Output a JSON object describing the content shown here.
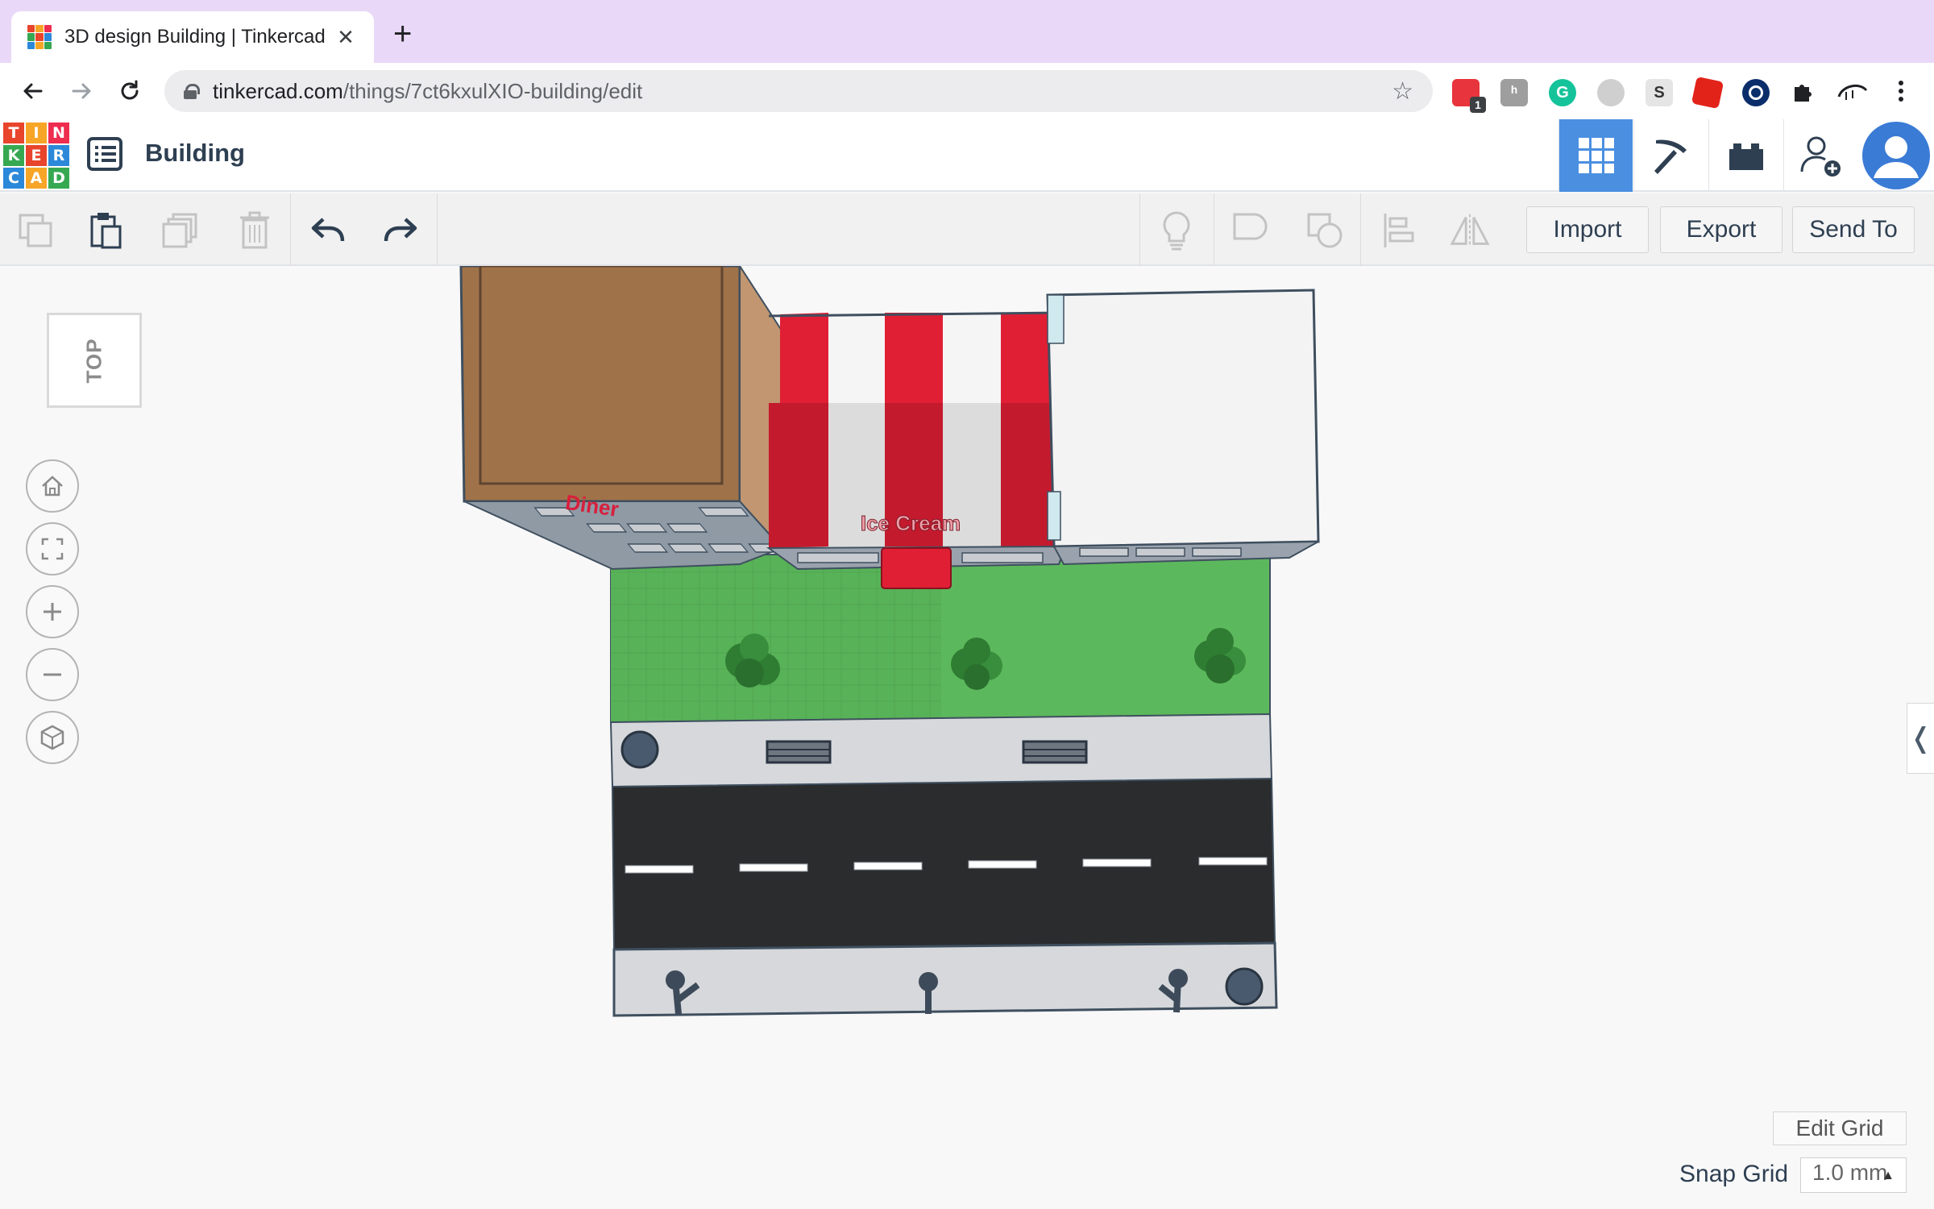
{
  "browser": {
    "tab_title": "3D design Building | Tinkercad",
    "tab_close": "✕",
    "new_tab": "+",
    "url_domain": "tinkercad.com",
    "url_path": "/things/7ct6kxulXIO-building/edit",
    "extension_badge": "1",
    "icons": [
      "back-arrow-icon",
      "forward-arrow-icon",
      "reload-icon",
      "lock-icon",
      "bookmark-star-icon",
      "puzzle-extensions-icon",
      "menu-dots-icon"
    ]
  },
  "app": {
    "logo_letters": [
      "T",
      "I",
      "N",
      "K",
      "E",
      "R",
      "C",
      "A",
      "D"
    ],
    "logo_colors": [
      "#e8452c",
      "#f7a526",
      "#ee2d4f",
      "#36a852",
      "#e8452c",
      "#2c88d9",
      "#2c88d9",
      "#f7a526",
      "#36a852"
    ],
    "design_title": "Building",
    "header_buttons": [
      "3d-view-grid-icon",
      "minecraft-pickaxe-icon",
      "lego-brick-icon",
      "add-user-icon",
      "profile-avatar"
    ],
    "accent_color": "#4a8fe0"
  },
  "toolbar": {
    "left_icons": [
      "copy-icon",
      "paste-icon",
      "duplicate-icon",
      "delete-icon",
      "undo-icon",
      "redo-icon"
    ],
    "right_icons": [
      "note-lightbulb-icon",
      "group-icon",
      "ungroup-icon",
      "align-icon",
      "mirror-icon"
    ],
    "import_label": "Import",
    "export_label": "Export",
    "send_to_label": "Send To"
  },
  "workplane": {
    "viewcube_label": "TOP",
    "view_buttons": [
      "home-view-icon",
      "fit-view-icon",
      "zoom-in-icon",
      "zoom-out-icon",
      "perspective-icon"
    ],
    "side_tab": "❬",
    "edit_grid_label": "Edit Grid",
    "snap_grid_label": "Snap Grid",
    "snap_grid_value": "1.0 mm",
    "scene_signs": [
      "Diner",
      "Ice Cream"
    ],
    "scene_colors": {
      "road": "#2a2c2e",
      "sidewalk": "#d6d8db",
      "grass": "#5cb85c",
      "awning_red": "#e01f35",
      "brick": "#a07249"
    }
  }
}
